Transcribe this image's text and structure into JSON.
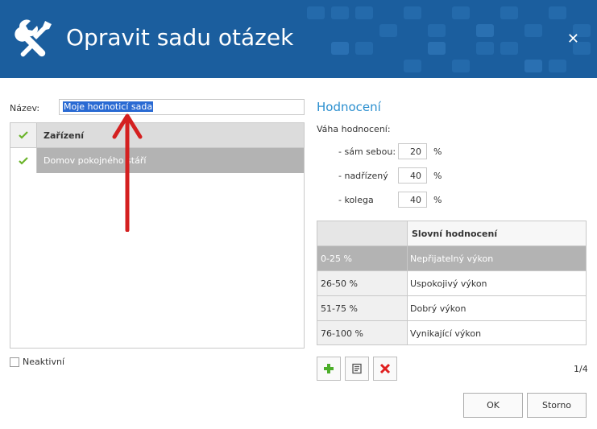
{
  "header": {
    "title": "Opravit sadu otázek",
    "icon": "wrench-screwdriver-icon",
    "bg_color": "#1b5e9e"
  },
  "form": {
    "name_label": "Název:",
    "name_value": "Moje hodnoticí sada",
    "inactive_label": "Neaktivní",
    "inactive_checked": false
  },
  "devices": {
    "header": "Zařízení",
    "rows": [
      {
        "label": "Domov pokojného stáří",
        "checked": true
      }
    ]
  },
  "rating": {
    "title": "Hodnocení",
    "weights_label": "Váha hodnocení:",
    "weights": [
      {
        "label": "- sám sebou:",
        "value": "20",
        "unit": "%"
      },
      {
        "label": "- nadřízený",
        "value": "40",
        "unit": "%"
      },
      {
        "label": "- kolega",
        "value": "40",
        "unit": "%"
      }
    ],
    "table_header": "Slovní hodnocení",
    "rows": [
      {
        "range": "0-25 %",
        "text": "Nepřijatelný výkon"
      },
      {
        "range": "26-50 %",
        "text": "Uspokojivý výkon"
      },
      {
        "range": "51-75 %",
        "text": "Dobrý výkon"
      },
      {
        "range": "76-100 %",
        "text": "Vynikající výkon"
      }
    ],
    "pagination": "1/4"
  },
  "buttons": {
    "ok": "OK",
    "cancel": "Storno"
  },
  "colors": {
    "accent": "#2b8fcf",
    "check": "#6ab32a",
    "add": "#4cae2a",
    "delete": "#e02020",
    "annotation": "#d42020"
  }
}
